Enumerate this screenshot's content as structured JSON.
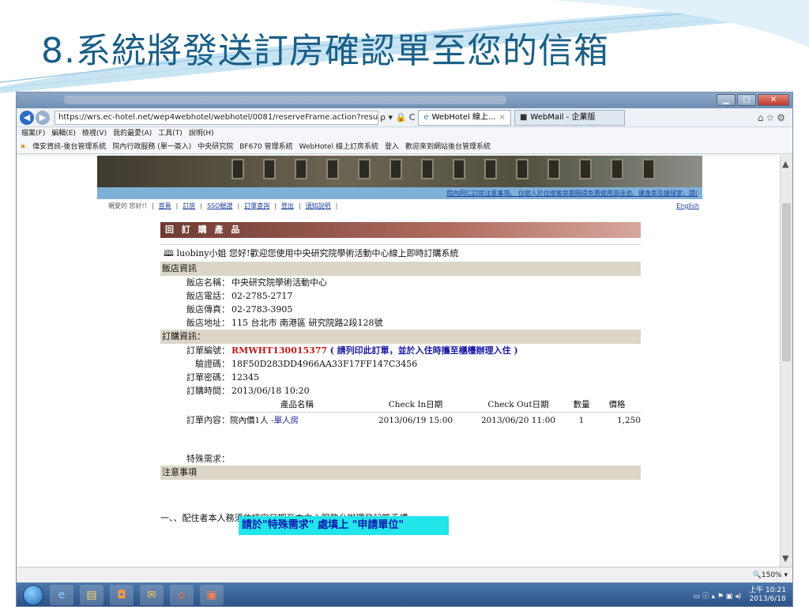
{
  "slide": {
    "title": "8.系統將發送訂房確認單至您的信箱"
  },
  "browser": {
    "address_url": "https://wrs.ec-hotel.net/wep4webhotel/webhotel/0081/reserveFrame.action?result=si",
    "address_tools": "ρ ▾ 🔒 C",
    "tabs": [
      {
        "label": "WebHotel 線上...",
        "active": true
      },
      {
        "label": "WebMail - 企業版",
        "active": false
      }
    ],
    "menu": [
      "檔案(F)",
      "編輯(E)",
      "檢視(V)",
      "我的最愛(A)",
      "工具(T)",
      "說明(H)"
    ],
    "favorites": [
      "偉安資訊-後台管理系統",
      "院內行政服務 (單一簽入)",
      "中央研究院",
      "BF670 管理系統",
      "WebHotel 線上訂房系統",
      "登入",
      "歡迎來到網站後台管理系統"
    ],
    "zoom": "🔍150% ▾"
  },
  "site": {
    "notice_link": "院內同仁訂房注意事項，  住宿人於住宿客房期間得免費使用游泳池、健身房及撞球室，請(",
    "greeting": "親愛的 您好!!",
    "nav": [
      "首頁",
      "訂房",
      "SSO驗證",
      "訂單查詢",
      "登出",
      "須知說明"
    ],
    "english": "English",
    "order_header": "回 訂 購 產 品",
    "welcome": "luobiny小姐 您好!歡迎您使用中央研究院學術活動中心線上即時訂購系統",
    "hotel_section": "飯店資訊",
    "hotel": {
      "name_label": "飯店名稱：",
      "name": "中央研究院學術活動中心",
      "phone_label": "飯店電話：",
      "phone": "02-2785-2717",
      "fax_label": "飯店傳真：",
      "fax": "02-2783-3905",
      "address_label": "飯店地址：",
      "address": "115 台北市 南港區 研究院路2段128號"
    },
    "order_section": "訂購資訊：",
    "order": {
      "number_label": "訂單編號：",
      "number": "RMWHT130015377",
      "number_note": "( 請列印此訂單，並於入住時攜至櫃檯辦理入住 )",
      "verify_label": "驗證碼：",
      "verify": "18F50D283DD4966AA33F17FF147C3456",
      "password_label": "訂單密碼：",
      "password": "12345",
      "time_label": "訂購時間：",
      "time": "2013/06/18 10:20",
      "content_label": "訂單內容：",
      "special_label": "特殊需求："
    },
    "product_table": {
      "headers": [
        "產品名稱",
        "Check In日期",
        "Check Out日期",
        "數量",
        "價格"
      ],
      "rows": [
        {
          "prefix": "院內價1人 -",
          "room": "單人房",
          "checkin": "2013/06/19 15:00",
          "checkout": "2013/06/20 11:00",
          "qty": "1",
          "price": "1,250"
        }
      ]
    },
    "highlight": "請於\"特殊需求\" 處填上   \"申請單位\"",
    "notice_section": "注意事項",
    "notice_1": "一、、配住者本人務須依核定日期至本中心服務台辦理登記等手續。"
  },
  "taskbar": {
    "clock_time": "上午 10:21",
    "clock_date": "2013/6/18"
  }
}
